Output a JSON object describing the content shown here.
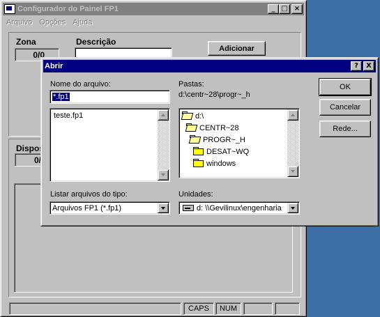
{
  "main": {
    "title": "Configurador do Painel FP1",
    "menu": [
      "Arquivo",
      "Opções",
      "Ajuda"
    ],
    "zona_label": "Zona",
    "zona_value": "0/0",
    "descricao_label": "Descrição",
    "descricao_value": "",
    "add_button": "Adicionar",
    "dispositivo_label": "Dispos",
    "dispositivo_value": "0/",
    "status": {
      "caps": "CAPS",
      "num": "NUM"
    }
  },
  "dialog": {
    "title": "Abrir",
    "filename_label": "Nome do arquivo:",
    "filename_value": "*.fp1",
    "files": [
      "teste.fp1"
    ],
    "folders_label": "Pastas:",
    "current_path": "d:\\centr~28\\progr~_h",
    "folders": [
      "d:\\",
      "CENTR~28",
      "PROGR~_H",
      "DESAT~WQ",
      "windows"
    ],
    "filetype_label": "Listar arquivos do tipo:",
    "filetype_value": "Arquivos FP1 (*.fp1)",
    "drives_label": "Unidades:",
    "drive_value": "d: \\\\Gevilinux\\engenharia",
    "ok_button": "OK",
    "cancel_button": "Cancelar",
    "network_button": "Rede...",
    "help_button": "?",
    "close_button": "X"
  },
  "colors": {
    "desktop": "#3a6ea5",
    "active_title": "#000080",
    "inactive_title": "#808080",
    "face": "#c0c0c0"
  }
}
